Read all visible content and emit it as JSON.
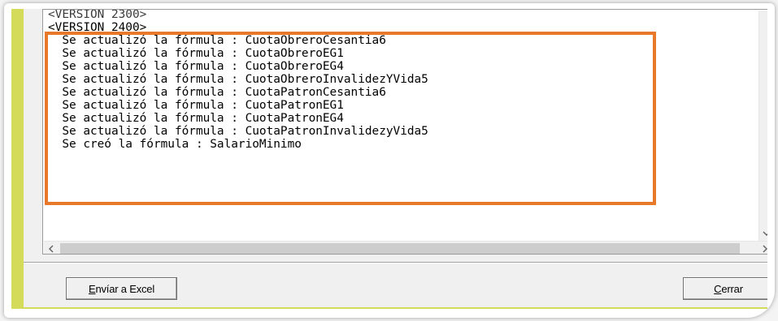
{
  "log": {
    "lines": [
      "<VERSION 2300>",
      "<VERSION 2400>",
      "  Se actualizó la fórmula : CuotaObreroCesantia6",
      "  Se actualizó la fórmula : CuotaObreroEG1",
      "  Se actualizó la fórmula : CuotaObreroEG4",
      "  Se actualizó la fórmula : CuotaObreroInvalidezYVida5",
      "  Se actualizó la fórmula : CuotaPatronCesantia6",
      "  Se actualizó la fórmula : CuotaPatronEG1",
      "  Se actualizó la fórmula : CuotaPatronEG4",
      "  Se actualizó la fórmula : CuotaPatronInvalidezyVida5",
      "  Se creó la fórmula : SalarioMinimo"
    ]
  },
  "buttons": {
    "export_accel": "E",
    "export_rest": "nvíar a Excel",
    "close_accel": "C",
    "close_rest": "errar"
  },
  "icons": {
    "scroll_down": "chevron-down-icon",
    "scroll_left": "chevron-left-icon",
    "scroll_right": "chevron-right-icon"
  },
  "colors": {
    "highlight": "#e8782a",
    "window_accent": "#d4da5a"
  }
}
